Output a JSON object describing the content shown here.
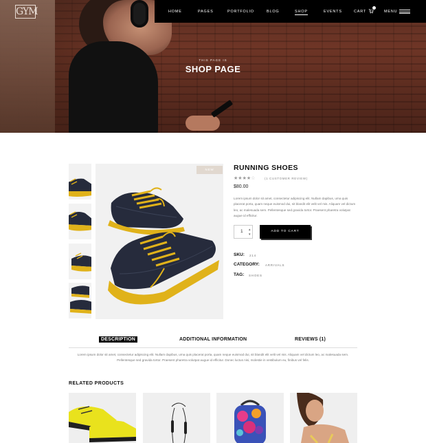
{
  "header": {
    "logo_text": "GYM",
    "nav": [
      "HOME",
      "PAGES",
      "PORTFOLIO",
      "BLOG",
      "SHOP",
      "EVENTS"
    ],
    "active_nav": "SHOP",
    "cart_label": "CART",
    "cart_count": 0,
    "menu_label": "MENU"
  },
  "hero": {
    "subtitle": "THIS PAGE IS",
    "title": "SHOP PAGE"
  },
  "product": {
    "badge": "NEW",
    "name": "RUNNING SHOES",
    "rating": 4,
    "rating_max": 5,
    "review_text": "(1 CUSTOMER REVIEW)",
    "price": "$80.00",
    "description": "Lorem ipsum dolor sit amet, consectetur adipiscing elit. Nullam dapibus, urna quis placerat porta, quam neque euismod dui, sit blandit elit velit vel mis. Aliquam vel dictum leo, ac malesuada sem. Pellentesque sed gravida tortor. Praesent pharetra volutpat augue id efficitur.",
    "quantity": "1",
    "add_to_cart": "ADD TO CART",
    "meta": {
      "sku_label": "SKU:",
      "sku": "214",
      "category_label": "CATEGORY:",
      "category": "ARRIVALS",
      "tag_label": "TAG:",
      "tag": "SHOES"
    }
  },
  "tabs": {
    "items": [
      "DESCRIPTION",
      "ADDITIONAL INFORMATION",
      "REVIEWS (1)"
    ],
    "active": "DESCRIPTION",
    "content": "Lorem ipsum dolor sit amet, consectetur adipiscing elit. Nullam dapibus, urna quis placerat porta, quam neque euismod dui, sit blandit elit velit vel mis. Aliquam vel dictum leo, ac malesuada sem. Pellentesque sed gravida tortor. Praesent pharetra volutpat augue id efficitur. Donec luctus nisi, molestie in vestibulum eu, finibus vel felis."
  },
  "related": {
    "title": "RELATED PRODUCTS"
  },
  "colors": {
    "accent": "#000000",
    "shoe_body": "#262b3c",
    "shoe_sole": "#e0b21a",
    "badge": "#e1d8cf"
  }
}
